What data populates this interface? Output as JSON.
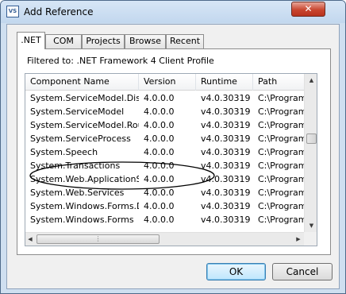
{
  "window": {
    "title": "Add Reference",
    "close_glyph": "✕",
    "icon_text": "VS"
  },
  "tabs": [
    ".NET",
    "COM",
    "Projects",
    "Browse",
    "Recent"
  ],
  "filter_label": "Filtered to: .NET Framework 4 Client Profile",
  "columns": [
    "Component Name",
    "Version",
    "Runtime",
    "Path"
  ],
  "rows": [
    [
      "System.ServiceModel.Disc...",
      "4.0.0.0",
      "v4.0.30319",
      "C:\\Program"
    ],
    [
      "System.ServiceModel",
      "4.0.0.0",
      "v4.0.30319",
      "C:\\Program"
    ],
    [
      "System.ServiceModel.Rout...",
      "4.0.0.0",
      "v4.0.30319",
      "C:\\Program"
    ],
    [
      "System.ServiceProcess",
      "4.0.0.0",
      "v4.0.30319",
      "C:\\Program"
    ],
    [
      "System.Speech",
      "4.0.0.0",
      "v4.0.30319",
      "C:\\Program"
    ],
    [
      "System.Transactions",
      "4.0.0.0",
      "v4.0.30319",
      "C:\\Program"
    ],
    [
      "System.Web.ApplicationSe...",
      "4.0.0.0",
      "v4.0.30319",
      "C:\\Program"
    ],
    [
      "System.Web.Services",
      "4.0.0.0",
      "v4.0.30319",
      "C:\\Program"
    ],
    [
      "System.Windows.Forms.D...",
      "4.0.0.0",
      "v4.0.30319",
      "C:\\Program"
    ],
    [
      "System.Windows.Forms",
      "4.0.0.0",
      "v4.0.30319",
      "C:\\Program"
    ]
  ],
  "highlighted_row": "System.Speech",
  "scroll": {
    "up": "▲",
    "down": "▼",
    "left": "◀",
    "right": "▶",
    "grip": "⋮"
  },
  "buttons": {
    "ok": "OK",
    "cancel": "Cancel"
  },
  "colors": {
    "highlight_ellipse": "#000000",
    "accent": "#3c7fb1"
  }
}
